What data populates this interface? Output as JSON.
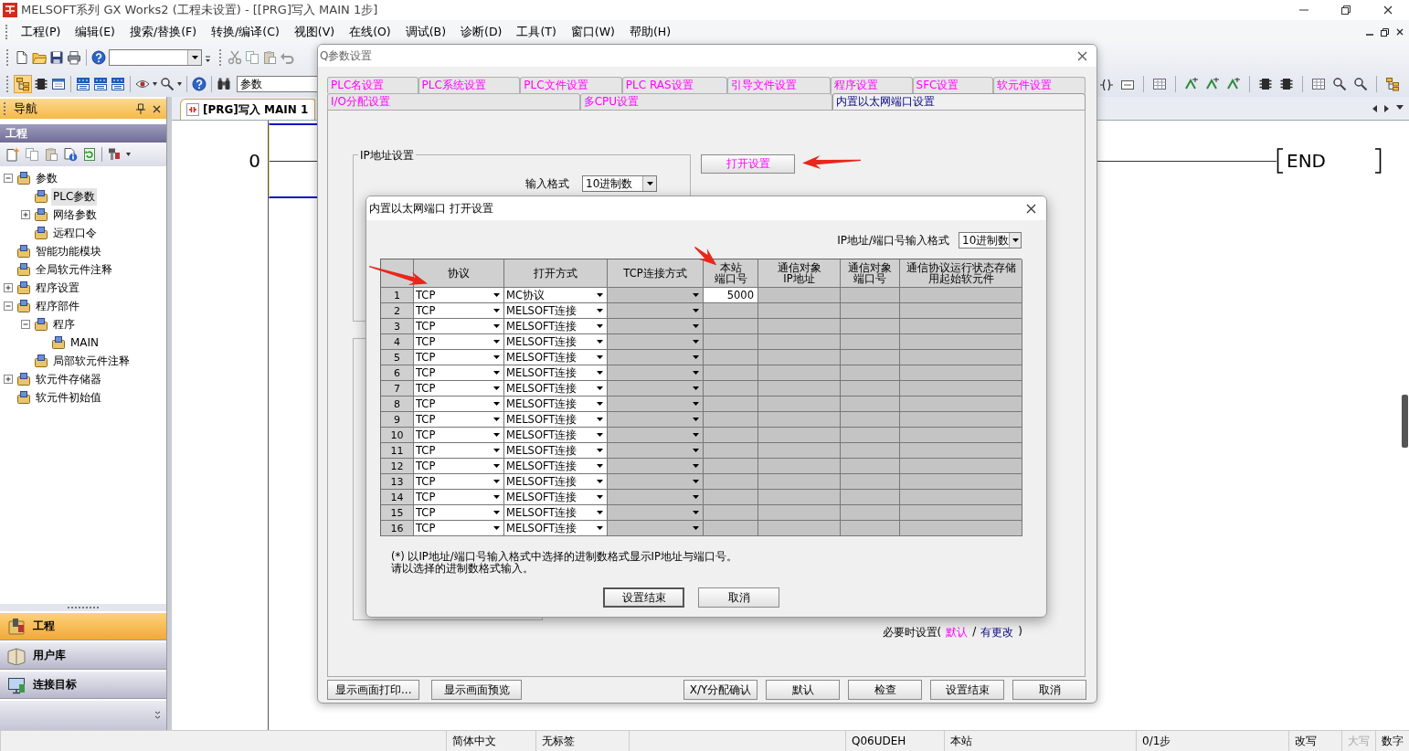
{
  "window": {
    "title": "MELSOFT系列 GX Works2 (工程未设置) - [[PRG]写入 MAIN 1步]"
  },
  "menu": [
    "工程(P)",
    "编辑(E)",
    "搜索/替换(F)",
    "转换/编译(C)",
    "视图(V)",
    "在线(O)",
    "调试(B)",
    "诊断(D)",
    "工具(T)",
    "窗口(W)",
    "帮助(H)"
  ],
  "toolbar": {
    "combo_value": "参数"
  },
  "navigation": {
    "title": "导航",
    "section": "工程",
    "tree": [
      {
        "label": "参数",
        "expanded": true,
        "selected": false,
        "children": [
          {
            "label": "PLC参数",
            "selected": true
          },
          {
            "label": "网络参数",
            "expanded": false,
            "selected": false
          },
          {
            "label": "远程口令",
            "selected": false
          }
        ]
      },
      {
        "label": "智能功能模块",
        "selected": false
      },
      {
        "label": "全局软元件注释",
        "selected": false
      },
      {
        "label": "程序设置",
        "expanded": false,
        "selected": false
      },
      {
        "label": "程序部件",
        "expanded": true,
        "selected": false,
        "children": [
          {
            "label": "程序",
            "expanded": true,
            "selected": false,
            "children": [
              {
                "label": "MAIN",
                "selected": false
              }
            ]
          },
          {
            "label": "局部软元件注释",
            "selected": false
          }
        ]
      },
      {
        "label": "软元件存储器",
        "expanded": false,
        "selected": false
      },
      {
        "label": "软元件初始值",
        "selected": false
      }
    ],
    "tabs": [
      {
        "label": "工程",
        "selected": true
      },
      {
        "label": "用户库",
        "selected": false
      },
      {
        "label": "连接目标",
        "selected": false
      }
    ]
  },
  "editor": {
    "tab": "[PRG]写入 MAIN 1",
    "step": "0",
    "end_instruction": "END"
  },
  "parameter_dialog": {
    "title": "Q参数设置",
    "tab_rows": [
      [
        {
          "label": "PLC名设置",
          "selected": false,
          "modified": false
        },
        {
          "label": "PLC系统设置",
          "selected": false,
          "modified": false
        },
        {
          "label": "PLC文件设置",
          "selected": false,
          "modified": false
        },
        {
          "label": "PLC RAS设置",
          "selected": false,
          "modified": false
        },
        {
          "label": "引导文件设置",
          "selected": false,
          "modified": false
        },
        {
          "label": "程序设置",
          "selected": false,
          "modified": false
        },
        {
          "label": "SFC设置",
          "selected": false,
          "modified": false
        },
        {
          "label": "软元件设置",
          "selected": false,
          "modified": false
        }
      ],
      [
        {
          "label": "I/O分配设置",
          "selected": false,
          "modified": false
        },
        {
          "label": "多CPU设置",
          "selected": false,
          "modified": false
        },
        {
          "label": "内置以太网端口设置",
          "selected": true,
          "modified": true
        }
      ]
    ],
    "ip_group": "IP地址设置",
    "input_format_label": "输入格式",
    "input_format_value": "10进制数",
    "open_settings_button": {
      "label": "打开设置",
      "modified": false
    },
    "legend": {
      "prefix": "必要时设置(",
      "default": "默认",
      "separator": "/",
      "modified": "有更改",
      "suffix": ")"
    },
    "left_buttons": [
      "显示画面打印...",
      "显示画面预览"
    ],
    "right_buttons": [
      "X/Y分配确认",
      "默认",
      "检查",
      "设置结束",
      "取消"
    ]
  },
  "open_dialog": {
    "title": "内置以太网端口 打开设置",
    "format_label": "IP地址/端口号输入格式",
    "format_value": "10进制数",
    "columns": [
      [
        "协议"
      ],
      [
        "打开方式"
      ],
      [
        "TCP连接方式"
      ],
      [
        "本站",
        "端口号"
      ],
      [
        "通信对象",
        "IP地址"
      ],
      [
        "通信对象",
        "端口号"
      ],
      [
        "通信协议运行状态存储",
        "用起始软元件"
      ]
    ],
    "rows": [
      {
        "number": "1",
        "protocol": "TCP",
        "open_method": "MC协议",
        "port": "5000",
        "port_enabled": true
      },
      {
        "number": "2",
        "protocol": "TCP",
        "open_method": "MELSOFT连接",
        "port_enabled": false
      },
      {
        "number": "3",
        "protocol": "TCP",
        "open_method": "MELSOFT连接",
        "port_enabled": false
      },
      {
        "number": "4",
        "protocol": "TCP",
        "open_method": "MELSOFT连接",
        "port_enabled": false
      },
      {
        "number": "5",
        "protocol": "TCP",
        "open_method": "MELSOFT连接",
        "port_enabled": false
      },
      {
        "number": "6",
        "protocol": "TCP",
        "open_method": "MELSOFT连接",
        "port_enabled": false
      },
      {
        "number": "7",
        "protocol": "TCP",
        "open_method": "MELSOFT连接",
        "port_enabled": false
      },
      {
        "number": "8",
        "protocol": "TCP",
        "open_method": "MELSOFT连接",
        "port_enabled": false
      },
      {
        "number": "9",
        "protocol": "TCP",
        "open_method": "MELSOFT连接",
        "port_enabled": false
      },
      {
        "number": "10",
        "protocol": "TCP",
        "open_method": "MELSOFT连接",
        "port_enabled": false
      },
      {
        "number": "11",
        "protocol": "TCP",
        "open_method": "MELSOFT连接",
        "port_enabled": false
      },
      {
        "number": "12",
        "protocol": "TCP",
        "open_method": "MELSOFT连接",
        "port_enabled": false
      },
      {
        "number": "13",
        "protocol": "TCP",
        "open_method": "MELSOFT连接",
        "port_enabled": false
      },
      {
        "number": "14",
        "protocol": "TCP",
        "open_method": "MELSOFT连接",
        "port_enabled": false
      },
      {
        "number": "15",
        "protocol": "TCP",
        "open_method": "MELSOFT连接",
        "port_enabled": false
      },
      {
        "number": "16",
        "protocol": "TCP",
        "open_method": "MELSOFT连接",
        "port_enabled": false
      }
    ],
    "notes": [
      "(*) 以IP地址/端口号输入格式中选择的进制数格式显示IP地址与端口号。",
      "请以选择的进制数格式输入。"
    ],
    "buttons": [
      {
        "label": "设置结束",
        "default": true
      },
      {
        "label": "取消",
        "default": false
      }
    ]
  },
  "status_bar": [
    {
      "text": "简体中文",
      "disabled": false
    },
    {
      "text": "无标签",
      "disabled": false
    },
    {
      "text": "Q06UDEH",
      "disabled": false
    },
    {
      "text": "本站",
      "disabled": false
    },
    {
      "text": "0/1步",
      "disabled": false
    },
    {
      "text": "改写",
      "disabled": false
    },
    {
      "text": "大写",
      "disabled": true
    },
    {
      "text": "数字",
      "disabled": false
    }
  ]
}
